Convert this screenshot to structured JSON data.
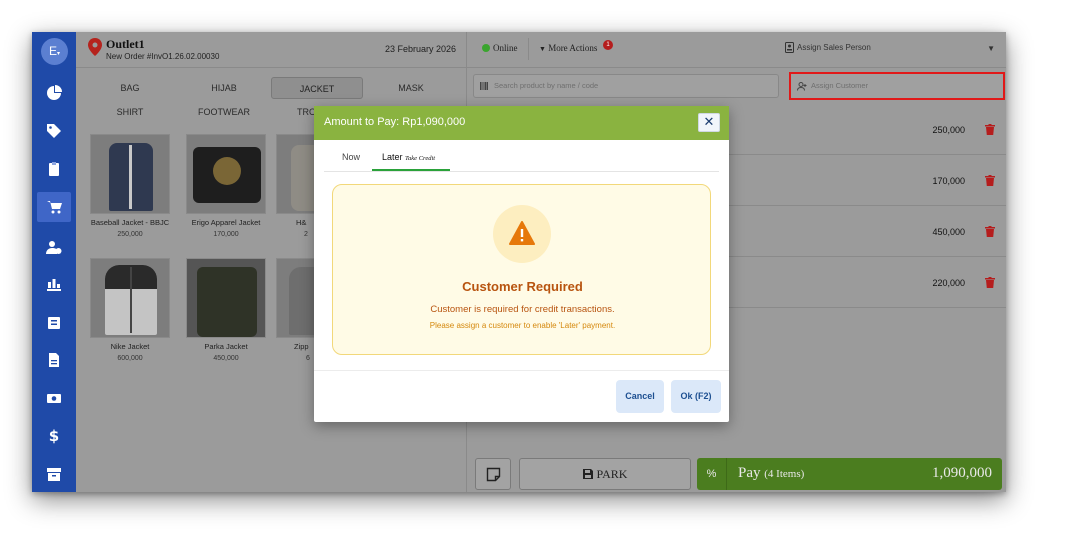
{
  "sidebar": {
    "avatar_letter": "E",
    "icons": [
      "dashboard-icon",
      "tag-icon",
      "clipboard-icon",
      "cart-icon",
      "user-clock-icon",
      "chart-icon",
      "report-icon",
      "document-icon",
      "cash-icon",
      "dollar-icon",
      "archive-icon"
    ]
  },
  "header": {
    "outlet_name": "Outlet1",
    "order_number": "New Order #InvO1.26.02.00030",
    "date": "23 February 2026"
  },
  "categories": [
    "BAG",
    "HIJAB",
    "JACKET",
    "MASK",
    "SHIRT",
    "FOOTWEAR",
    "TRO"
  ],
  "active_category": "JACKET",
  "products": [
    {
      "name": "Baseball Jacket - BBJC",
      "price": "250,000"
    },
    {
      "name": "Erigo Apparel Jacket",
      "price": "170,000"
    },
    {
      "name": "H&",
      "price": "2"
    },
    {
      "name": "Nike Jacket",
      "price": "600,000"
    },
    {
      "name": "Parka Jacket",
      "price": "450,000"
    },
    {
      "name": "Zipp",
      "price": "6"
    }
  ],
  "right_top": {
    "status": "Online",
    "more_actions": "More Actions",
    "more_badge": "1",
    "sales_person": "Assign Sales Person"
  },
  "search": {
    "placeholder": "Search product by name / code"
  },
  "customer": {
    "placeholder": "Assign Customer"
  },
  "cart_lines": [
    "250,000",
    "170,000",
    "450,000",
    "220,000"
  ],
  "bottom": {
    "park": "PARK",
    "percent": "%",
    "pay_label": "Pay",
    "pay_items": "(4 Items)",
    "total": "1,090,000"
  },
  "modal": {
    "title_prefix": "Amount to Pay:",
    "amount": "Rp1,090,000",
    "close": "✕",
    "tab_now": "Now",
    "tab_later": "Later",
    "tab_later_sub": "Take Credit",
    "alert_title": "Customer Required",
    "alert_message": "Customer is required for credit transactions.",
    "alert_sub": "Please assign a customer to enable 'Later' payment.",
    "cancel": "Cancel",
    "ok": "Ok (F2)"
  },
  "colors": {
    "sidebar": "#1f4aa8",
    "modal_header": "#8ab340",
    "pay_button": "#4b7d1f",
    "alert_text": "#b85410",
    "highlight": "#e11919"
  }
}
